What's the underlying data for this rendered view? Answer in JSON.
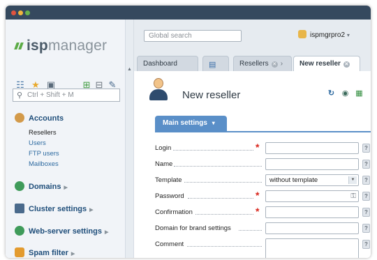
{
  "app": {
    "logo_prefix": "isp",
    "logo_suffix": "manager",
    "user_name": "ispmgrpro2",
    "user_caret": "▾"
  },
  "search": {
    "global_placeholder": "Global search",
    "sidebar_placeholder": "Ctrl + Shift + M"
  },
  "sidebar": {
    "sections": [
      {
        "label": "Accounts",
        "icon": "user-icon",
        "color": "#d39a4a"
      },
      {
        "label": "Domains",
        "icon": "globe-icon",
        "color": "#3f9b5a"
      },
      {
        "label": "Cluster settings",
        "icon": "server-icon",
        "color": "#4a6a8c"
      },
      {
        "label": "Web-server settings",
        "icon": "globe-icon",
        "color": "#3f9b5a"
      },
      {
        "label": "Spam filter",
        "icon": "shield-icon",
        "color": "#e39b2f"
      }
    ],
    "account_items": [
      "Resellers",
      "Users",
      "FTP users",
      "Mailboxes"
    ],
    "active_item": "Resellers"
  },
  "tabs": [
    {
      "label": "Dashboard"
    },
    {
      "label": ""
    },
    {
      "label": "Resellers"
    },
    {
      "label": "New reseller"
    }
  ],
  "page": {
    "title": "New reseller",
    "settings_tab": "Main settings",
    "settings_caret": "▾"
  },
  "form": {
    "login_label": "Login",
    "name_label": "Name",
    "template_label": "Template",
    "template_value": "without template",
    "password_label": "Password",
    "confirmation_label": "Confirmation",
    "brand_label": "Domain for brand settings",
    "comment_label": "Comment",
    "required_mark": "*",
    "help_mark": "?"
  },
  "colors": {
    "accent": "#5a8fc8",
    "required": "#d9261c",
    "titlebar": "#35495e",
    "logo_green": "#5bab46"
  }
}
